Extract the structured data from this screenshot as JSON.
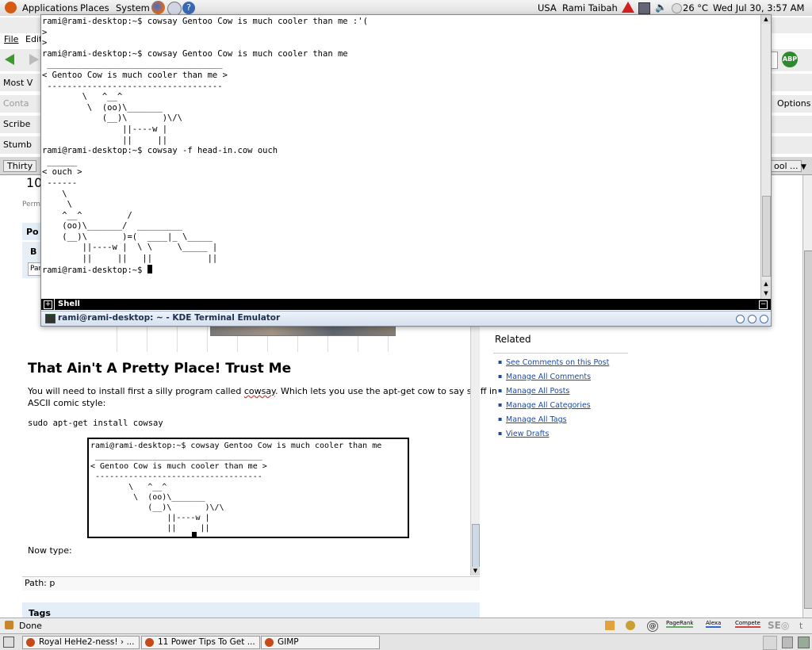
{
  "top_panel": {
    "menus": [
      "Applications",
      "Places",
      "System"
    ],
    "keyboard_layout": "USA",
    "user": "Rami Taibah",
    "temperature": "26 °C",
    "datetime": "Wed Jul 30,  3:57 AM"
  },
  "browser": {
    "menu": {
      "file": "File",
      "edit": "Edit"
    },
    "bookmarks": [
      "Most V",
      "Conta",
      "Scribe",
      "Stumb"
    ],
    "tab_left": "Thirty",
    "options_label": "Options",
    "tab_right": "ool ...",
    "abp": "ABP",
    "status_text": "Done",
    "status_icons": [
      "PageRank",
      "Alexa",
      "Compete"
    ]
  },
  "editor": {
    "partial_number": "10",
    "perm": "Perm",
    "post_label": "Po",
    "bold_btn": "B",
    "para_select": "Par",
    "heading": "That Ain't A Pretty Place! Trust Me",
    "para1_a": "You will need to install first a silly program called ",
    "para1_link": "cowsay",
    "para1_b": ". Which lets you use the apt-get cow to say stuff in",
    "para1_c": "ASCII comic style:",
    "code_line": "sudo apt-get install cowsay",
    "inner_terminal": "rami@rami-desktop:~$ cowsay Gentoo Cow is much cooler than me\n ___________________________________\n< Gentoo Cow is much cooler than me >\n -----------------------------------\n        \\   ^__^\n         \\  (oo)\\_______\n            (__)\\       )\\/\\\n                ||----w |\n                ||     ||",
    "now_type": "Now type:",
    "path": "Path: p",
    "tags": "Tags"
  },
  "sidebar": {
    "title": "Related",
    "links": [
      "See Comments on this Post",
      "Manage All Comments",
      "Manage All Posts",
      "Manage All Categories",
      "Manage All Tags",
      "View Drafts"
    ]
  },
  "terminal": {
    "content": "rami@rami-desktop:~$ cowsay Gentoo Cow is much cooler than me :'(\n>\n>\nrami@rami-desktop:~$ cowsay Gentoo Cow is much cooler than me\n ___________________________________\n< Gentoo Cow is much cooler than me >\n -----------------------------------\n        \\   ^__^\n         \\  (oo)\\_______\n            (__)\\       )\\/\\\n                ||----w |\n                ||     ||\nrami@rami-desktop:~$ cowsay -f head-in.cow ouch\n ______\n< ouch >\n ------\n    \\\n     \\\n    ^__^         /\n    (oo)\\_______/  _________\n    (__)\\       )=(  ____|_ \\_____\n        ||----w |  \\ \\     \\_____ |\n        ||     ||   ||           ||\nrami@rami-desktop:~$ ",
    "tab_label": "Shell",
    "window_title": "rami@rami-desktop: ~ - KDE Terminal Emulator"
  },
  "taskbar": {
    "items": [
      "Royal HeHe2-ness! › ...",
      "11 Power Tips To Get ...",
      "GIMP"
    ]
  }
}
